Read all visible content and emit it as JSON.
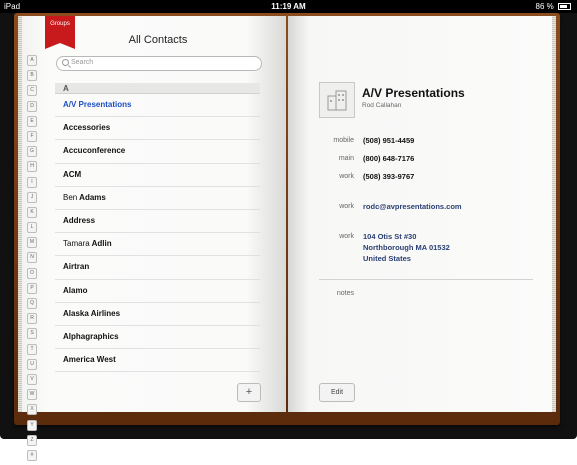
{
  "statusbar": {
    "carrier": "iPad",
    "time": "11:19 AM",
    "battery": "86 %"
  },
  "left_page": {
    "ribbon_label": "Groups",
    "title": "All Contacts",
    "search_placeholder": "Search",
    "index_letters": [
      "A",
      "B",
      "C",
      "D",
      "E",
      "F",
      "G",
      "H",
      "I",
      "J",
      "K",
      "L",
      "M",
      "N",
      "O",
      "P",
      "Q",
      "R",
      "S",
      "T",
      "U",
      "V",
      "W",
      "X",
      "Y",
      "Z",
      "#"
    ],
    "section_header": "A",
    "contacts": [
      {
        "first": "",
        "last": "A/V Presentations",
        "selected": true
      },
      {
        "first": "",
        "last": "Accessories"
      },
      {
        "first": "",
        "last": "Accuconference"
      },
      {
        "first": "",
        "last": "ACM"
      },
      {
        "first": "Ben",
        "last": "Adams"
      },
      {
        "first": "",
        "last": "Address"
      },
      {
        "first": "Tamara",
        "last": "Adlin"
      },
      {
        "first": "",
        "last": "Airtran"
      },
      {
        "first": "",
        "last": "Alamo"
      },
      {
        "first": "",
        "last": "Alaska Airlines"
      },
      {
        "first": "",
        "last": "Alphagraphics"
      },
      {
        "first": "",
        "last": "America West"
      }
    ],
    "add_label": "+"
  },
  "right_page": {
    "name": "A/V Presentations",
    "subtitle": "Rod Callahan",
    "fields": [
      {
        "label": "mobile",
        "value": "(508) 951-4459"
      },
      {
        "label": "main",
        "value": "(800) 648-7176"
      },
      {
        "label": "work",
        "value": "(508) 393-9767"
      },
      {
        "label": "work",
        "value": "rodc@avpresentations.com"
      },
      {
        "label": "work",
        "value": "104 Otis St #30",
        "value2": "Northborough MA 01532",
        "value3": "United States"
      }
    ],
    "notes_label": "notes",
    "edit_label": "Edit"
  }
}
